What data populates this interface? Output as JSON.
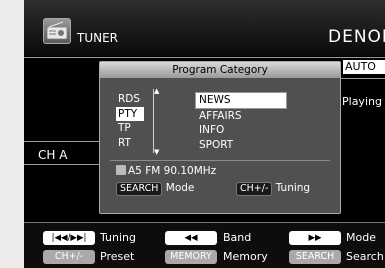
{
  "header": {
    "source_label": "TUNER",
    "brand": "DENON",
    "source_icon": "radio-icon"
  },
  "side": {
    "auto_label": "AUTO",
    "playing_label": "Playing",
    "channel_label": "CH A"
  },
  "dialog": {
    "title": "Program Category",
    "modes": [
      "RDS",
      "PTY",
      "TP",
      "RT"
    ],
    "selected_mode": "PTY",
    "categories": [
      "NEWS",
      "AFFAIRS",
      "INFO",
      "SPORT"
    ],
    "selected_category": "NEWS",
    "status_text": "A5 FM 90.10MHz",
    "search_key": "SEARCH",
    "search_hint": "Mode",
    "ch_key": "CH+/-",
    "ch_hint": "Tuning"
  },
  "footer": {
    "row1": [
      {
        "key": "|◀◀/▶▶|",
        "label": "Tuning"
      },
      {
        "key": "◀◀",
        "label": "Band"
      },
      {
        "key": "▶▶",
        "label": "Mode"
      }
    ],
    "row2": [
      {
        "key": "CH+/-",
        "label": "Preset"
      },
      {
        "key": "MEMORY",
        "label": "Memory"
      },
      {
        "key": "SEARCH",
        "label": "Search"
      }
    ]
  }
}
